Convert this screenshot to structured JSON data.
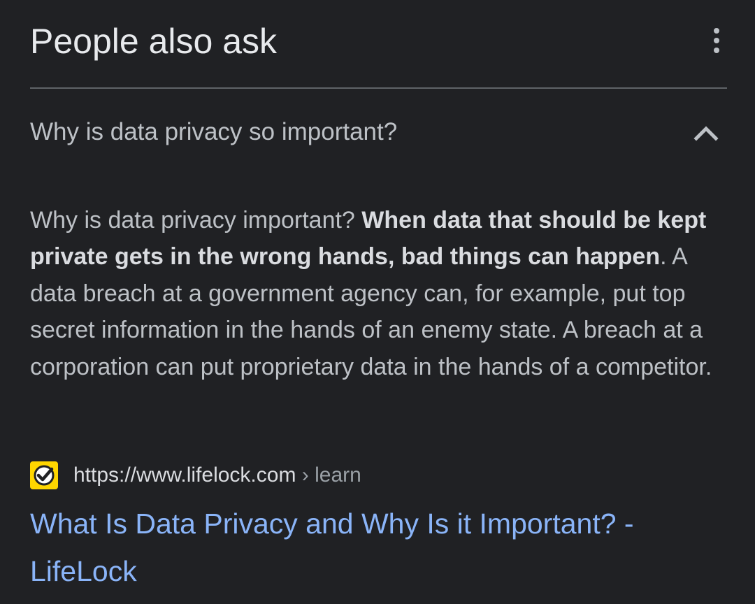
{
  "header": {
    "title": "People also ask",
    "more_icon": "more-vert-icon"
  },
  "question": {
    "text": "Why is data privacy so important?",
    "expanded": true,
    "toggle_icon": "chevron-up-icon"
  },
  "answer": {
    "lead": "Why is data privacy important? ",
    "highlight": "When data that should be kept private gets in the wrong hands, bad things can happen",
    "rest": ". A data breach at a government agency can, for example, put top secret information in the hands of an enemy state. A breach at a corporation can put proprietary data in the hands of a competitor."
  },
  "source": {
    "favicon": "lifelock-favicon-icon",
    "url": "https://www.lifelock.com",
    "path": " › learn"
  },
  "result": {
    "title": "What Is Data Privacy and Why Is it Important? - LifeLock"
  },
  "colors": {
    "background": "#202124",
    "title_text": "#e8eaed",
    "body_text": "#bdc1c6",
    "link": "#8ab4f8",
    "divider": "#5f6368",
    "favicon_bg": "#ffd600"
  }
}
